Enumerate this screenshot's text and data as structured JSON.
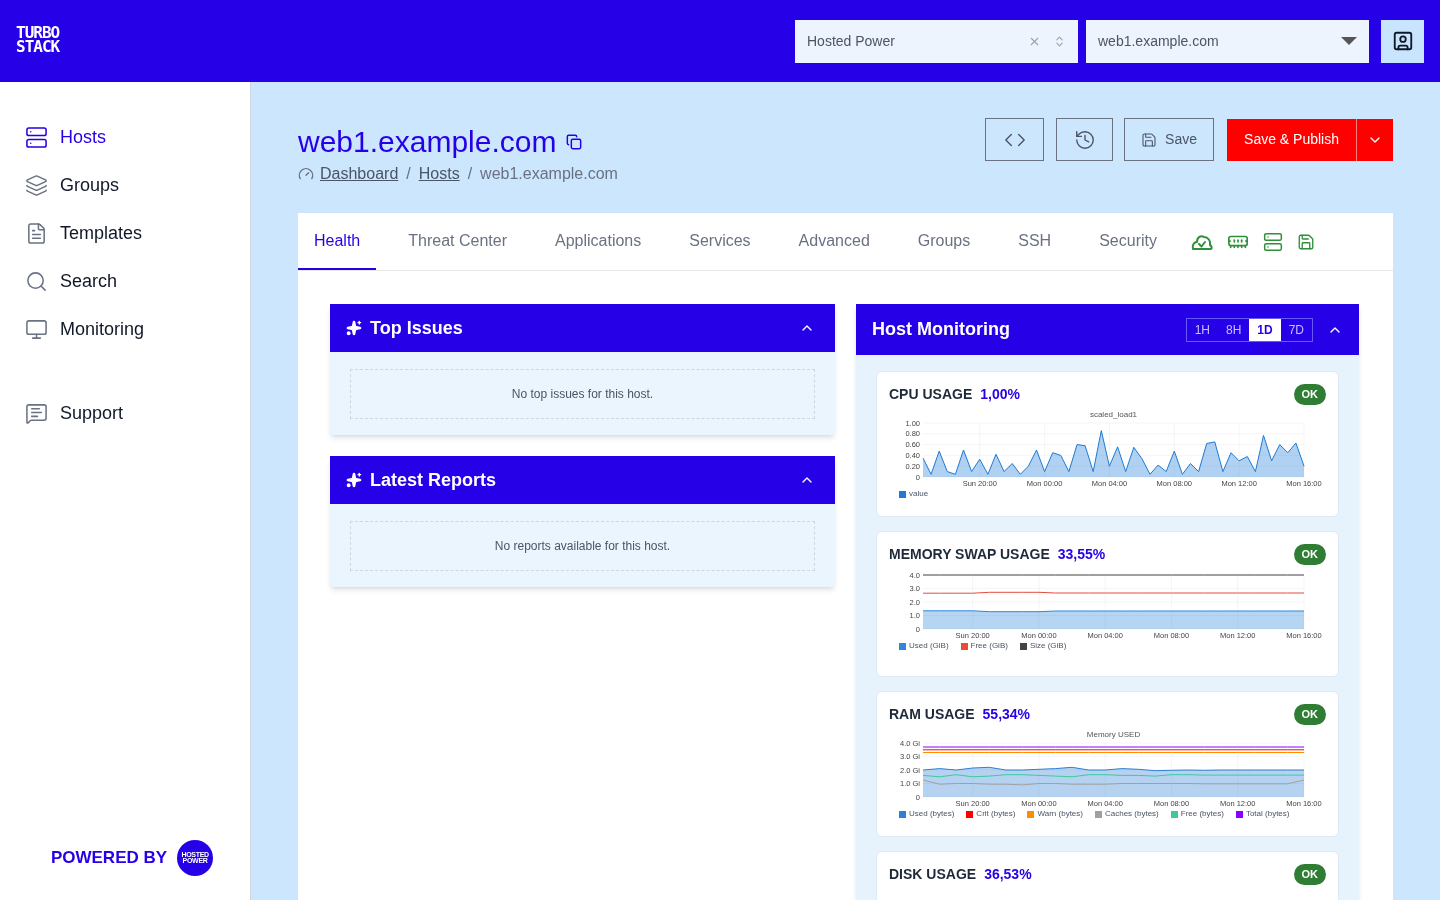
{
  "brand": {
    "logo_lines": [
      "TURBO",
      "STACK"
    ]
  },
  "header": {
    "organization_select": {
      "value": "Hosted Power"
    },
    "host_select": {
      "value": "web1.example.com"
    }
  },
  "sidebar": {
    "items": [
      {
        "label": "Hosts",
        "selected": true
      },
      {
        "label": "Groups",
        "selected": false
      },
      {
        "label": "Templates",
        "selected": false
      },
      {
        "label": "Search",
        "selected": false
      },
      {
        "label": "Monitoring",
        "selected": false
      }
    ],
    "secondary_items": [
      {
        "label": "Support",
        "selected": false
      }
    ],
    "footer": {
      "text": "POWERED BY",
      "logo_lines": [
        "HOSTED",
        "POWER"
      ]
    }
  },
  "page": {
    "title": "web1.example.com",
    "breadcrumb": [
      {
        "label": "Dashboard",
        "link": true
      },
      {
        "label": "Hosts",
        "link": true,
        "separator": "/"
      },
      {
        "label": "web1.example.com",
        "link": false,
        "separator": "/"
      }
    ],
    "actions": {
      "save": "Save",
      "publish": "Save & Publish"
    }
  },
  "tabs": [
    {
      "label": "Health",
      "selected": true
    },
    {
      "label": "Threat Center",
      "selected": false
    },
    {
      "label": "Applications",
      "selected": false
    },
    {
      "label": "Services",
      "selected": false
    },
    {
      "label": "Advanced",
      "selected": false
    },
    {
      "label": "Groups",
      "selected": false
    },
    {
      "label": "SSH",
      "selected": false
    },
    {
      "label": "Security",
      "selected": false
    }
  ],
  "panels": [
    {
      "title": "Top Issues",
      "expanded": true,
      "empty_text": "No top issues for this host."
    },
    {
      "title": "Latest Reports",
      "expanded": true,
      "empty_text": "No reports available for this host."
    }
  ],
  "monitoring": {
    "title": "Host Monitoring",
    "expanded": true,
    "ranges": [
      {
        "label": "1H",
        "selected": false
      },
      {
        "label": "8H",
        "selected": false
      },
      {
        "label": "1D",
        "selected": true
      },
      {
        "label": "7D",
        "selected": false
      }
    ],
    "cards": [
      {
        "title": "CPU USAGE",
        "value": "1,00%",
        "status": "OK",
        "chart_data": {
          "type": "area",
          "title": "scaled_load1",
          "grid": true,
          "legend": "bottom-left",
          "categories": [
            null,
            null,
            null,
            null,
            null,
            null,
            null,
            "Sun 20:00",
            null,
            null,
            null,
            null,
            null,
            null,
            null,
            "Mon 00:00",
            null,
            null,
            null,
            null,
            null,
            null,
            null,
            "Mon 04:00",
            null,
            null,
            null,
            null,
            null,
            null,
            null,
            "Mon 08:00",
            null,
            null,
            null,
            null,
            null,
            null,
            null,
            "Mon 12:00",
            null,
            null,
            null,
            null,
            null,
            null,
            null,
            "Mon 16:00"
          ],
          "series": [
            {
              "name": "value",
              "type": "area",
              "color": "#1e7ad6",
              "values": [
                0.35,
                0.05,
                0.48,
                0.1,
                0.05,
                0.5,
                0.1,
                0.33,
                0.05,
                0.42,
                0.1,
                0.25,
                0.05,
                0.2,
                0.5,
                0.1,
                0.45,
                0.4,
                0.1,
                0.6,
                0.58,
                0.1,
                0.86,
                0.2,
                0.56,
                0.1,
                0.55,
                0.34,
                0.05,
                0.22,
                0.1,
                0.48,
                0.05,
                0.25,
                0.1,
                0.62,
                0.65,
                0.1,
                0.45,
                0.3,
                0.38,
                0.1,
                0.77,
                0.3,
                0.6,
                0.45,
                0.63,
                0.2
              ]
            }
          ],
          "ylim": [
            0,
            1
          ],
          "yticks": [
            {
              "value": 0,
              "label": "0"
            },
            {
              "value": 0.2,
              "label": "0.20"
            },
            {
              "value": 0.4,
              "label": "0.40"
            },
            {
              "value": 0.6,
              "label": "0.60"
            },
            {
              "value": 0.8,
              "label": "0.80"
            },
            {
              "value": 1,
              "label": "1.00"
            }
          ]
        }
      },
      {
        "title": "MEMORY SWAP USAGE",
        "value": "33,55%",
        "status": "OK",
        "chart_data": {
          "type": "area",
          "grid": true,
          "legend": "bottom-left",
          "categories": [
            null,
            null,
            null,
            "Sun 20:00",
            null,
            null,
            null,
            "Mon 00:00",
            null,
            null,
            null,
            "Mon 04:00",
            null,
            null,
            null,
            "Mon 08:00",
            null,
            null,
            null,
            "Mon 12:00",
            null,
            null,
            null,
            "Mon 16:00"
          ],
          "series": [
            {
              "name": "Used (GiB)",
              "type": "area",
              "color": "#2e86de",
              "values": [
                1.35,
                1.35,
                1.35,
                1.35,
                1.28,
                1.28,
                1.28,
                1.28,
                1.33,
                1.33,
                1.33,
                1.33,
                1.33,
                1.33,
                1.33,
                1.33,
                1.33,
                1.33,
                1.33,
                1.33,
                1.33,
                1.33,
                1.33,
                1.33
              ]
            },
            {
              "name": "Free (GiB)",
              "type": "line",
              "color": "#e74c3c",
              "values": [
                2.65,
                2.65,
                2.65,
                2.65,
                2.72,
                2.72,
                2.72,
                2.72,
                2.67,
                2.67,
                2.67,
                2.67,
                2.67,
                2.67,
                2.67,
                2.67,
                2.67,
                2.67,
                2.67,
                2.67,
                2.67,
                2.67,
                2.67,
                2.67
              ]
            },
            {
              "name": "Size (GiB)",
              "type": "line",
              "color": "#444444",
              "values": [
                4,
                4,
                4,
                4,
                4,
                4,
                4,
                4,
                4,
                4,
                4,
                4,
                4,
                4,
                4,
                4,
                4,
                4,
                4,
                4,
                4,
                4,
                4,
                4
              ]
            }
          ],
          "ylim": [
            0,
            4
          ],
          "yticks": [
            {
              "value": 0,
              "label": "0"
            },
            {
              "value": 1,
              "label": "1.0"
            },
            {
              "value": 2,
              "label": "2.0"
            },
            {
              "value": 3,
              "label": "3.0"
            },
            {
              "value": 4,
              "label": "4.0"
            }
          ]
        }
      },
      {
        "title": "RAM USAGE",
        "value": "55,34%",
        "status": "OK",
        "chart_data": {
          "type": "area",
          "title": "Memory USED",
          "grid": true,
          "legend": "bottom-left",
          "categories": [
            null,
            null,
            null,
            "Sun 20:00",
            null,
            null,
            null,
            "Mon 00:00",
            null,
            null,
            null,
            "Mon 04:00",
            null,
            null,
            null,
            "Mon 08:00",
            null,
            null,
            null,
            "Mon 12:00",
            null,
            null,
            null,
            "Mon 16:00"
          ],
          "series": [
            {
              "name": "Used (bytes)",
              "type": "area",
              "color": "#2e7fd6",
              "values": [
                2.0,
                2.1,
                2.0,
                2.15,
                2.2,
                2.0,
                2.0,
                2.05,
                2.1,
                2.2,
                2.0,
                2.0,
                2.1,
                2.05,
                1.95,
                1.98,
                2.0,
                1.98,
                2.0,
                2.0,
                2.0,
                2.0,
                2.0,
                2.0
              ]
            },
            {
              "name": "Crit (bytes)",
              "type": "line",
              "color": "#ff0000",
              "values": [
                3.5,
                3.5,
                3.5,
                3.5,
                3.5,
                3.5,
                3.5,
                3.5,
                3.5,
                3.5,
                3.5,
                3.5,
                3.5,
                3.5,
                3.5,
                3.5,
                3.5,
                3.5,
                3.5,
                3.5,
                3.5,
                3.5,
                3.5,
                3.5
              ]
            },
            {
              "name": "Warn (bytes)",
              "type": "line",
              "color": "#ff8c00",
              "values": [
                3.3,
                3.3,
                3.3,
                3.3,
                3.3,
                3.3,
                3.3,
                3.3,
                3.3,
                3.3,
                3.3,
                3.3,
                3.3,
                3.3,
                3.3,
                3.3,
                3.3,
                3.3,
                3.3,
                3.3,
                3.3,
                3.3,
                3.3,
                3.3
              ]
            },
            {
              "name": "Caches (bytes)",
              "type": "line",
              "color": "#a0a0a0",
              "values": [
                1.25,
                0.95,
                1.0,
                1.0,
                0.95,
                0.95,
                0.9,
                1.0,
                1.0,
                0.95,
                0.95,
                0.95,
                1.0,
                1.0,
                1.0,
                1.0,
                1.0,
                0.98,
                0.98,
                0.98,
                0.98,
                0.98,
                0.98,
                1.25
              ]
            },
            {
              "name": "Free (bytes)",
              "type": "line",
              "color": "#3dc9a0",
              "values": [
                1.6,
                1.5,
                1.65,
                1.5,
                1.55,
                1.65,
                1.65,
                1.6,
                1.55,
                1.5,
                1.65,
                1.65,
                1.6,
                1.6,
                1.55,
                1.65,
                1.65,
                1.62,
                1.62,
                1.62,
                1.62,
                1.62,
                1.62,
                1.62
              ]
            },
            {
              "name": "Total (bytes)",
              "type": "line",
              "color": "#8a00ff",
              "values": [
                3.7,
                3.7,
                3.7,
                3.7,
                3.7,
                3.7,
                3.7,
                3.7,
                3.7,
                3.7,
                3.7,
                3.7,
                3.7,
                3.7,
                3.7,
                3.7,
                3.7,
                3.7,
                3.7,
                3.7,
                3.7,
                3.7,
                3.7,
                3.7
              ]
            }
          ],
          "ylim": [
            0,
            4
          ],
          "yticks": [
            {
              "value": 0,
              "label": "0"
            },
            {
              "value": 1,
              "label": "1.0 Gi"
            },
            {
              "value": 2,
              "label": "2.0 Gi"
            },
            {
              "value": 3,
              "label": "3.0 Gi"
            },
            {
              "value": 4,
              "label": "4.0 Gi"
            }
          ]
        }
      },
      {
        "title": "DISK USAGE",
        "value": "36,53%",
        "status": "OK"
      }
    ]
  }
}
